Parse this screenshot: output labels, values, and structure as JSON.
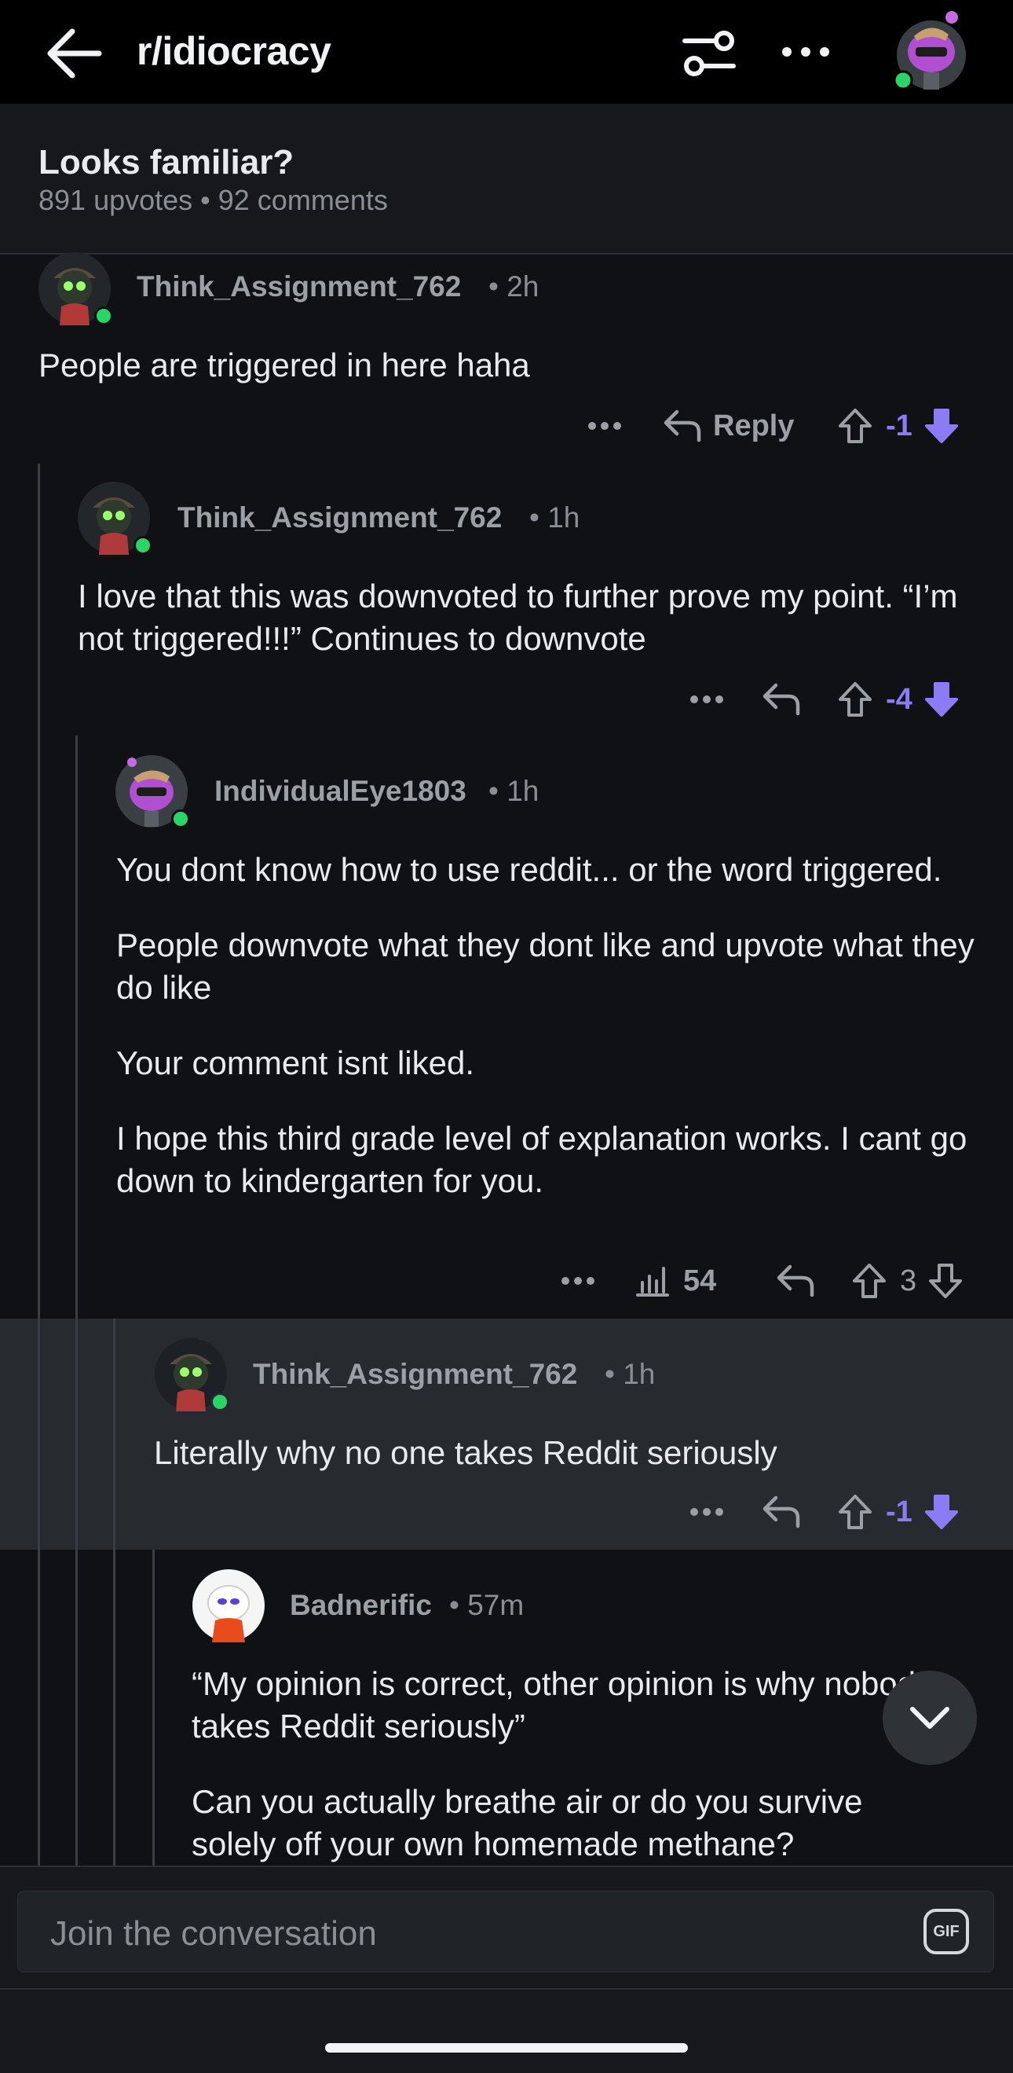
{
  "header": {
    "subreddit": "r/idiocracy",
    "icons": [
      "back-arrow-icon",
      "filter-icon",
      "more-icon",
      "avatar"
    ]
  },
  "post": {
    "title": "Looks familiar?",
    "meta": "891 upvotes • 92 comments"
  },
  "comments": [
    {
      "user": "Think_Assignment_762",
      "time": "• 2h",
      "text": [
        "People are triggered in here haha"
      ],
      "reply_label": "Reply",
      "score": "-1",
      "voted": "down"
    },
    {
      "user": "Think_Assignment_762",
      "time": "• 1h",
      "text": [
        "I love that this was downvoted to further prove my point. “I’m not triggered!!!” Continues to downvote"
      ],
      "score": "-4",
      "voted": "down"
    },
    {
      "user": "IndividualEye1803",
      "time": "• 1h",
      "text": [
        "You dont know how to use reddit... or the word triggered.",
        "People downvote what they dont like and upvote what they do like",
        "Your comment isnt liked.",
        "I hope this third grade level of explanation works.  I cant go down to kindergarten for you."
      ],
      "views": "54",
      "score": "3",
      "voted": "none"
    },
    {
      "user": "Think_Assignment_762",
      "time": "• 1h",
      "text": [
        "Literally why no one takes Reddit seriously"
      ],
      "score": "-1",
      "voted": "down"
    },
    {
      "user": "Badnerific",
      "time": "• 57m",
      "text": [
        "“My opinion is correct, other opinion is why nobody takes Reddit seriously”",
        "Can you actually breathe air or do you survive solely off your own homemade methane?"
      ]
    }
  ],
  "composer": {
    "placeholder": "Join the conversation",
    "gif_label": "GIF"
  },
  "colors": {
    "background": "#0f1114",
    "highlight": "#272b30",
    "downvote": "#8b7bf5",
    "online": "#2bd466"
  }
}
